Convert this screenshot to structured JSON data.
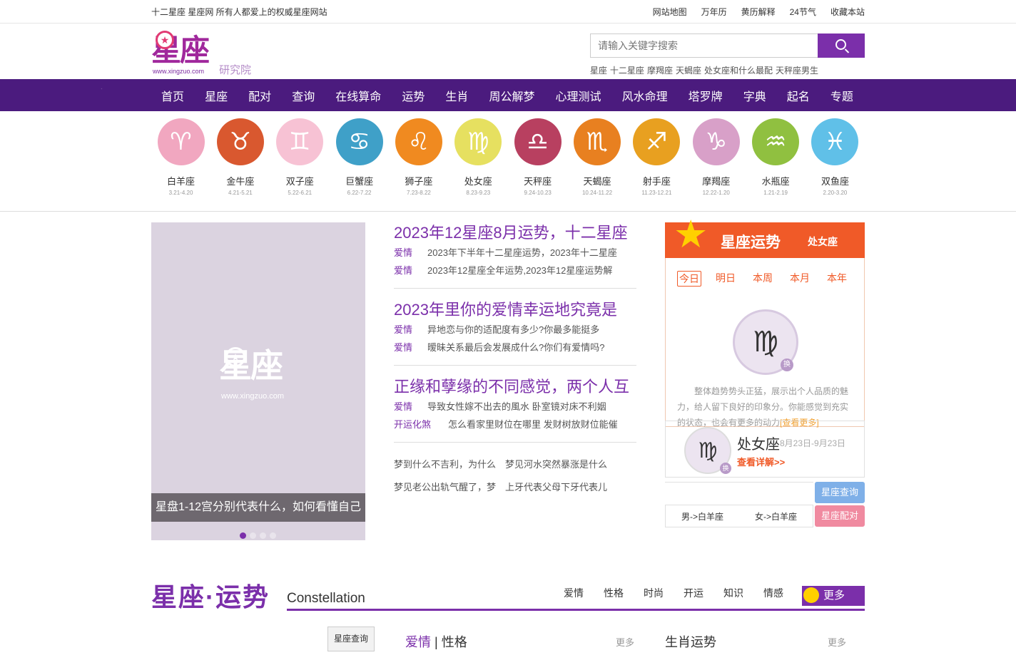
{
  "topbar": {
    "site_desc": "十二星座 星座网 所有人都爱上的权威星座网站",
    "links": [
      "网站地图",
      "万年历",
      "黄历解释",
      "24节气",
      "收藏本站"
    ]
  },
  "header": {
    "logo_text": "星座",
    "logo_url": "www.xingzuo.com",
    "logo_sub": "研究院",
    "search_placeholder": "请输入关键字搜索",
    "hot_words": [
      "星座",
      "十二星座",
      "摩羯座",
      "天蝎座",
      "处女座和什么最配",
      "天秤座男生"
    ]
  },
  "nav": [
    "首页",
    "星座",
    "配对",
    "查询",
    "在线算命",
    "运势",
    "生肖",
    "周公解梦",
    "心理测试",
    "风水命理",
    "塔罗牌",
    "字典",
    "起名",
    "专题"
  ],
  "zodiac": [
    {
      "name": "白羊座",
      "date": "3.21-4.20",
      "icon": "aries-icon",
      "color": "#f1a7c0"
    },
    {
      "name": "金牛座",
      "date": "4.21-5.21",
      "icon": "taurus-icon",
      "color": "#d9582f"
    },
    {
      "name": "双子座",
      "date": "5.22-6.21",
      "icon": "gemini-icon",
      "color": "#f7c2d4"
    },
    {
      "name": "巨蟹座",
      "date": "6.22-7.22",
      "icon": "cancer-icon",
      "color": "#3fa0c8"
    },
    {
      "name": "狮子座",
      "date": "7.23-8.22",
      "icon": "leo-icon",
      "color": "#f08a20"
    },
    {
      "name": "处女座",
      "date": "8.23-9.23",
      "icon": "virgo-icon",
      "color": "#e6e060"
    },
    {
      "name": "天秤座",
      "date": "9.24-10.23",
      "icon": "libra-icon",
      "color": "#b84060"
    },
    {
      "name": "天蝎座",
      "date": "10.24-11.22",
      "icon": "scorpio-icon",
      "color": "#e88020"
    },
    {
      "name": "射手座",
      "date": "11.23-12.21",
      "icon": "sagittarius-icon",
      "color": "#e8a020"
    },
    {
      "name": "摩羯座",
      "date": "12.22-1.20",
      "icon": "capricorn-icon",
      "color": "#d8a0c8"
    },
    {
      "name": "水瓶座",
      "date": "1.21-2.19",
      "icon": "aquarius-icon",
      "color": "#90c040"
    },
    {
      "name": "双鱼座",
      "date": "2.20-3.20",
      "icon": "pisces-icon",
      "color": "#60c0e8"
    }
  ],
  "slider": {
    "watermark": "星座",
    "watermark_url": "www.xingzuo.com",
    "caption": "星盘1-12宫分别代表什么，如何看懂自己"
  },
  "news": [
    {
      "title": "2023年12星座8月运势，十二星座",
      "lines": [
        {
          "tag": "爱情",
          "text": "2023年下半年十二星座运势，2023年十二星座"
        },
        {
          "tag": "爱情",
          "text": "2023年12星座全年运势,2023年12星座运势解"
        }
      ]
    },
    {
      "title": "2023年里你的爱情幸运地究竟是",
      "lines": [
        {
          "tag": "爱情",
          "text": "异地恋与你的适配度有多少?你最多能挺多"
        },
        {
          "tag": "爱情",
          "text": "暧昧关系最后会发展成什么?你们有爱情吗?"
        }
      ]
    },
    {
      "title": "正缘和孽缘的不同感觉，两个人互",
      "lines": [
        {
          "tag": "爱情",
          "text": "导致女性嫁不出去的風水 卧室镜对床不利姻"
        },
        {
          "tag": "开运化煞",
          "text": "怎么看家里财位在哪里 发财树放财位能催"
        }
      ]
    }
  ],
  "dreams": [
    [
      "梦到什么不吉利，为什么",
      "梦见河水突然暴涨是什么"
    ],
    [
      "梦见老公出轨气醒了，梦",
      "上牙代表父母下牙代表儿"
    ]
  ],
  "fortune": {
    "title": "星座运势",
    "sign": "处女座",
    "tabs": [
      "今日",
      "明日",
      "本周",
      "本月",
      "本年"
    ],
    "swap": "换",
    "text": "整体趋势势头正猛，展示出个人品质的魅力，给人留下良好的印象分。你能感觉到充实的状态，也会有更多的动力",
    "more": "[查看更多]"
  },
  "sign_card": {
    "name": "处女座",
    "date": "8月23日-9月23日",
    "detail": "查看详解>>",
    "swap": "换"
  },
  "query": {
    "male": "男->白羊座",
    "female": "女->白羊座",
    "btn_query": "星座查询",
    "btn_match": "星座配对"
  },
  "section": {
    "title": "星座·运势",
    "en": "Constellation",
    "tabs": [
      "爱情",
      "性格",
      "时尚",
      "开运",
      "知识",
      "情感"
    ],
    "more": "更多"
  },
  "bottom": {
    "query_btn": "星座查询",
    "love": "爱情",
    "sep": "|",
    "character": "性格",
    "more": "更多",
    "zodiac_title": "生肖运势"
  },
  "colors": {
    "brand": "#7b2faa",
    "nav_bg": "#4b1b7e",
    "fortune_orange": "#f05a28"
  }
}
